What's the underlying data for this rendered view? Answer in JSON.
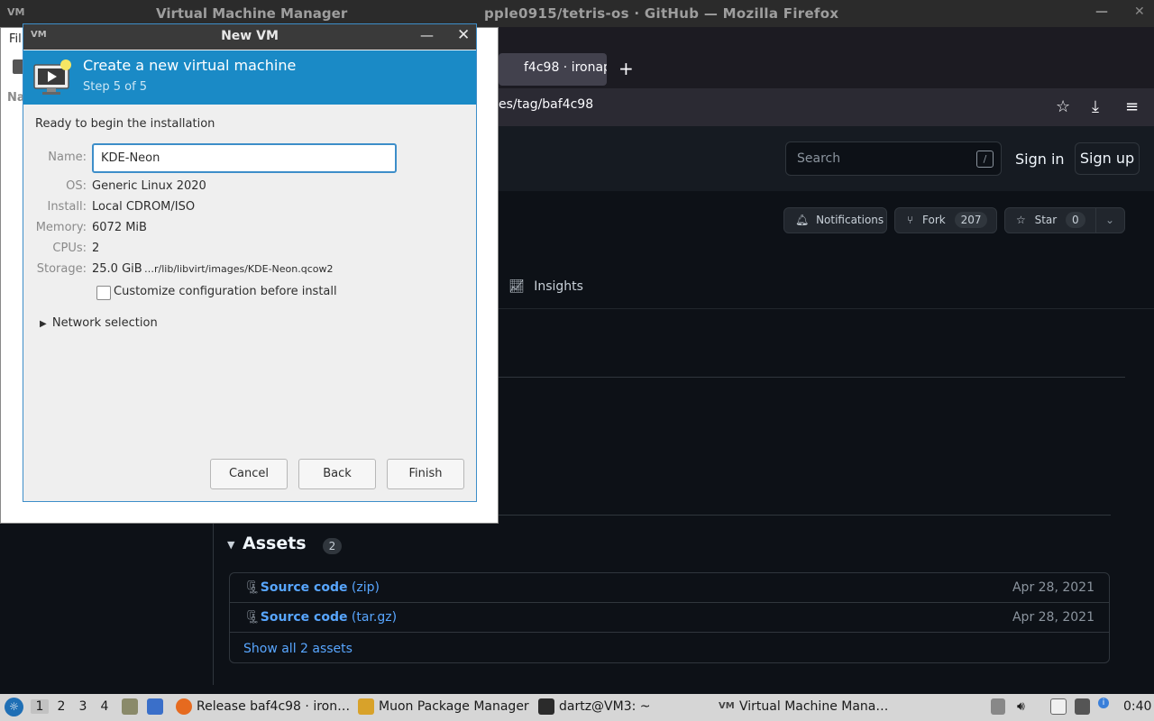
{
  "firefox": {
    "title": "pple0915/tetris-os · GitHub — Mozilla Firefox",
    "tab_label": "f4c98 · ironap",
    "new_tab": "+",
    "url": "es/tag/baf4c98"
  },
  "github": {
    "search_placeholder": "Search",
    "search_shortcut": "/",
    "sign_in": "Sign in",
    "sign_up": "Sign up",
    "notifications": "Notifications",
    "fork_label": "Fork",
    "fork_count": "207",
    "star_label": "Star",
    "star_count": "0",
    "insights": "Insights",
    "assets_title": "Assets",
    "assets_count": "2",
    "assets": [
      {
        "name": "Source code",
        "ext": "(zip)",
        "date": "Apr 28, 2021"
      },
      {
        "name": "Source code",
        "ext": "(tar.gz)",
        "date": "Apr 28, 2021"
      }
    ],
    "show_all": "Show all 2 assets"
  },
  "vmm": {
    "title": "Virtual Machine Manager",
    "menu_file": "Fil",
    "col_name": "Na"
  },
  "dialog": {
    "title": "New VM",
    "heading": "Create a new virtual machine",
    "step": "Step 5 of 5",
    "ready": "Ready to begin the installation",
    "name_label": "Name:",
    "name_value": "KDE-Neon",
    "os_label": "OS:",
    "os_value": "Generic Linux 2020",
    "install_label": "Install:",
    "install_value": "Local CDROM/ISO",
    "memory_label": "Memory:",
    "memory_value": "6072 MiB",
    "cpus_label": "CPUs:",
    "cpus_value": "2",
    "storage_label": "Storage:",
    "storage_value": "25.0 GiB",
    "storage_path": "…r/lib/libvirt/images/KDE-Neon.qcow2",
    "customize_label": "Customize configuration before install",
    "network_label": "Network selection",
    "cancel": "Cancel",
    "back": "Back",
    "finish": "Finish"
  },
  "taskbar": {
    "workspaces": [
      "1",
      "2",
      "3",
      "4"
    ],
    "tasks": [
      "Release baf4c98 · iron…",
      "Muon Package Manager",
      "dartz@VM3: ~",
      "Virtual Machine Mana…"
    ],
    "clock": "0:40"
  }
}
